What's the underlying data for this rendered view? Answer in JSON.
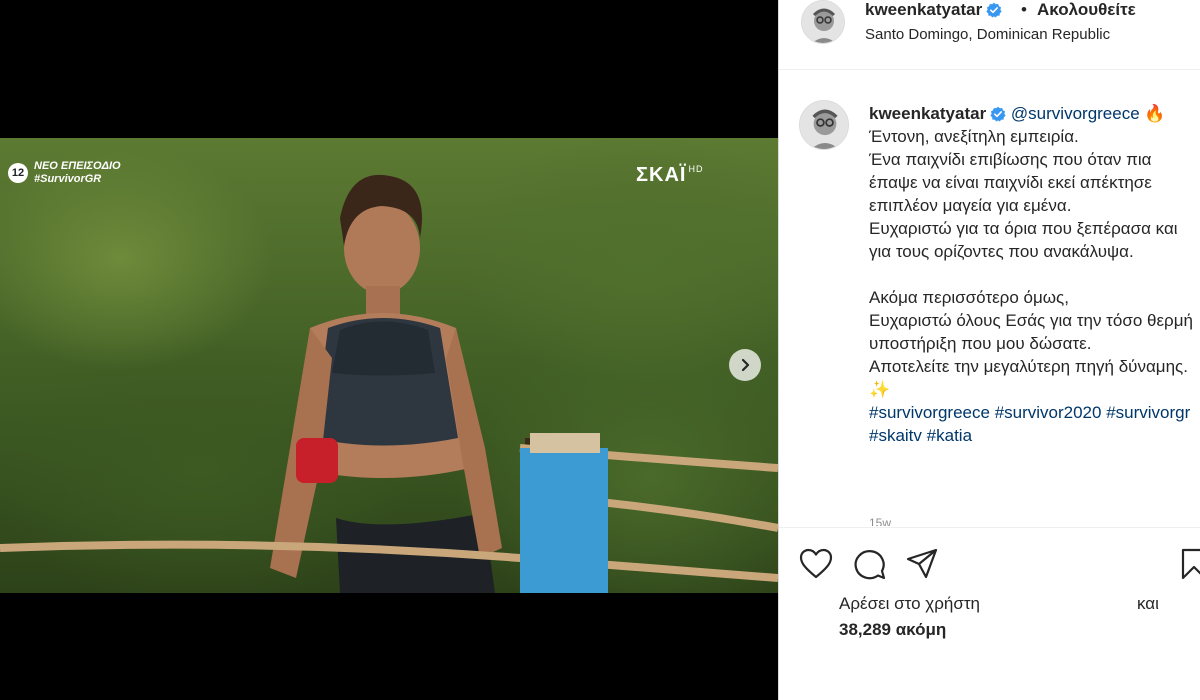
{
  "post": {
    "username": "kweenkatyatar",
    "separator": "•",
    "follow_label": "Ακολουθείτε",
    "location": "Santo Domingo, Dominican Republic"
  },
  "media": {
    "badge_channel": "12",
    "badge_line1": "ΝΕΟ ΕΠΕΙΣΟΔΙΟ",
    "badge_line2": "#SurvivorGR",
    "network_logo": "ΣΚΑΪ",
    "network_suffix": "HD",
    "next_icon": "chevron-right-icon"
  },
  "caption": {
    "username": "kweenkatyatar",
    "mention": "@survivorgreece",
    "emoji_fire": "🔥",
    "lines_p1": [
      "Έντονη, ανεξίτηλη εμπειρία.",
      "Ένα παιχνίδι επιβίωσης που όταν πια έπαψε να είναι παιχνίδι εκεί απέκτησε επιπλέον μαγεία για εμένα.",
      "Ευχαριστώ για τα όρια που ξεπέρασα και για τους ορίζοντες που ανακάλυψα."
    ],
    "lines_p2": [
      "Ακόμα περισσότερο όμως,",
      "Ευχαριστώ όλους Εσάς για την τόσο θερμή υποστήριξη που μου δώσατε.",
      "Αποτελείτε την μεγαλύτερη πηγή δύναμης."
    ],
    "emoji_sparkle": "✨",
    "hashtags": [
      "#survivorgreece",
      "#survivor2020",
      "#survivorgr",
      "#skaitv",
      "#katia"
    ],
    "time": "15w"
  },
  "actions": {
    "like_icon": "heart-icon",
    "comment_icon": "comment-icon",
    "share_icon": "send-icon",
    "save_icon": "bookmark-icon",
    "liked_by": "Αρέσει στο χρήστη",
    "and_label": "και",
    "likes_count": "38,289 ακόμη"
  },
  "colors": {
    "link": "#00376b",
    "verified": "#3897f0",
    "text": "#262626",
    "muted": "#8e8e8e"
  }
}
